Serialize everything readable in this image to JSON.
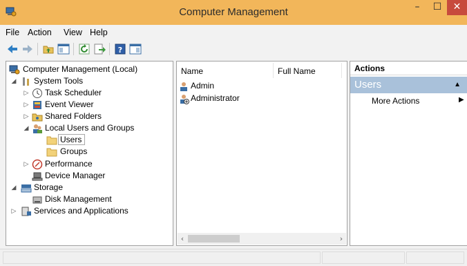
{
  "window": {
    "title": "Computer Management",
    "min_icon": "minimize-icon",
    "max_icon": "maximize-icon",
    "close_icon": "close-icon",
    "accent_color": "#f2b65a",
    "close_color": "#c74a3d"
  },
  "menu": {
    "file": "File",
    "action": "Action",
    "view": "View",
    "help": "Help"
  },
  "toolbar": {
    "buttons": [
      "back-icon",
      "forward-icon",
      "up-folder-icon",
      "show-hide-console-tree-icon",
      "refresh-icon",
      "export-list-icon",
      "help-icon",
      "show-hide-action-pane-icon"
    ]
  },
  "tree": {
    "root": "Computer Management (Local)",
    "system_tools": "System Tools",
    "task_scheduler": "Task Scheduler",
    "event_viewer": "Event Viewer",
    "shared_folders": "Shared Folders",
    "local_users_groups": "Local Users and Groups",
    "users": "Users",
    "groups": "Groups",
    "performance": "Performance",
    "device_manager": "Device Manager",
    "storage": "Storage",
    "disk_management": "Disk Management",
    "services_apps": "Services and Applications"
  },
  "list": {
    "columns": [
      "Name",
      "Full Name"
    ],
    "rows": [
      {
        "name": "Admin"
      },
      {
        "name": "Administrator"
      }
    ]
  },
  "actions": {
    "header": "Actions",
    "section": "Users",
    "more_actions": "More Actions",
    "section_color": "#a9c1da"
  }
}
